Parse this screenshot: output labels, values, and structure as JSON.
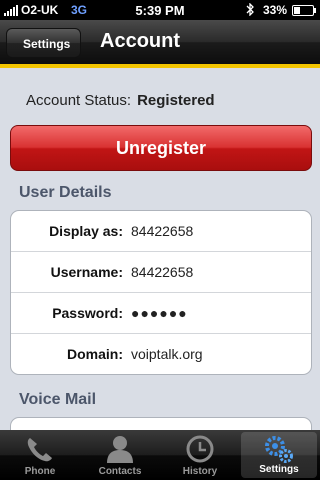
{
  "statusbar": {
    "carrier": "O2-UK",
    "network": "3G",
    "time": "5:39 PM",
    "battery_pct": "33%",
    "battery_level": 0.33,
    "icons": [
      "signal-icon",
      "bluetooth-icon",
      "battery-icon"
    ]
  },
  "navbar": {
    "back_label": "Settings",
    "title": "Account"
  },
  "account": {
    "status_label": "Account Status:",
    "status_value": "Registered",
    "unregister_label": "Unregister"
  },
  "user_details": {
    "title": "User Details",
    "rows": [
      {
        "label": "Display as:",
        "value": "84422658"
      },
      {
        "label": "Username:",
        "value": "84422658"
      },
      {
        "label": "Password:",
        "value": "●●●●●●"
      },
      {
        "label": "Domain:",
        "value": "voiptalk.org"
      }
    ]
  },
  "voice_mail": {
    "title": "Voice Mail"
  },
  "tabbar": {
    "tabs": [
      {
        "label": "Phone",
        "icon": "phone-icon"
      },
      {
        "label": "Contacts",
        "icon": "contacts-icon"
      },
      {
        "label": "History",
        "icon": "clock-icon"
      },
      {
        "label": "Settings",
        "icon": "gears-icon",
        "active": true
      }
    ]
  },
  "colors": {
    "accent_stripe": "#f2c400",
    "unregister_red": "#c11515",
    "section_title": "#4c566a",
    "background": "#d9dde5"
  }
}
